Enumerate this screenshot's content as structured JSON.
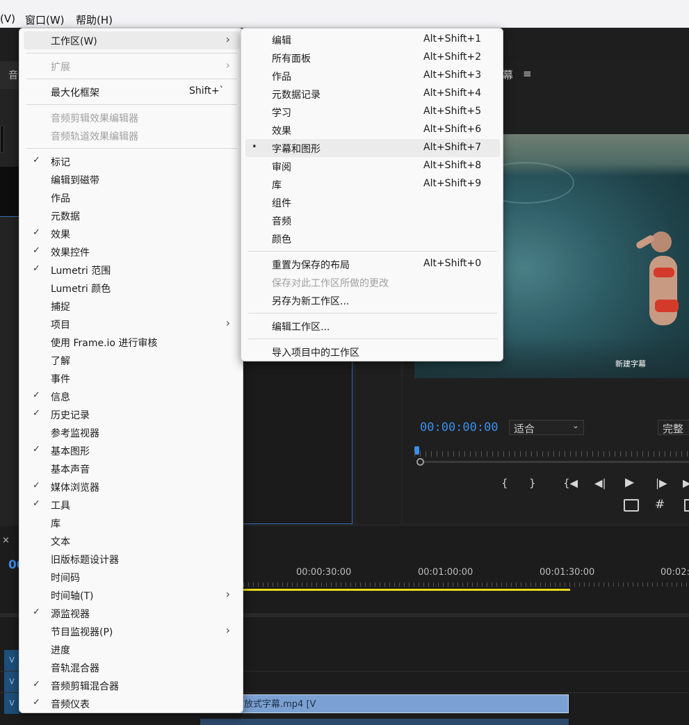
{
  "menubar": {
    "items": [
      {
        "label": "(V)"
      },
      {
        "label": "窗口(W)"
      },
      {
        "label": "帮助(H)"
      }
    ]
  },
  "panels": {
    "tab_partial_left": "音",
    "program_tab_partial": "幕",
    "program_menu_icon": "≡",
    "subtitle_overlay": "新建字幕",
    "timecode": "00:00:00:00",
    "fit_select": "适合",
    "quality_select": "完整",
    "timeline_tab_close": "×",
    "timeline_timecode_partial": "00",
    "ruler_labels": [
      "00:00:30:00",
      "00:01:00:00",
      "00:01:30:00",
      "00:02:"
    ],
    "track_labels": [
      "V",
      "V",
      "V"
    ],
    "clip_label": "放式字幕.mp4 [V"
  },
  "window_menu": {
    "items": [
      {
        "label": "工作区(W)",
        "submenu": true,
        "highlighted": true
      },
      {
        "sep": true
      },
      {
        "label": "扩展",
        "submenu": true,
        "disabled": true
      },
      {
        "sep": true
      },
      {
        "label": "最大化框架",
        "shortcut": "Shift+`"
      },
      {
        "sep": true
      },
      {
        "label": "音频剪辑效果编辑器",
        "disabled": true
      },
      {
        "label": "音频轨道效果编辑器",
        "disabled": true
      },
      {
        "sep": true
      },
      {
        "label": "标记",
        "checked": true
      },
      {
        "label": "编辑到磁带"
      },
      {
        "label": "作品"
      },
      {
        "label": "元数据"
      },
      {
        "label": "效果",
        "checked": true
      },
      {
        "label": "效果控件",
        "checked": true
      },
      {
        "label": "Lumetri 范围",
        "checked": true
      },
      {
        "label": "Lumetri 颜色"
      },
      {
        "label": "捕捉"
      },
      {
        "label": "项目",
        "submenu": true
      },
      {
        "label": "使用 Frame.io 进行审核"
      },
      {
        "label": "了解"
      },
      {
        "label": "事件"
      },
      {
        "label": "信息",
        "checked": true
      },
      {
        "label": "历史记录",
        "checked": true
      },
      {
        "label": "参考监视器"
      },
      {
        "label": "基本图形",
        "checked": true
      },
      {
        "label": "基本声音"
      },
      {
        "label": "媒体浏览器",
        "checked": true
      },
      {
        "label": "工具",
        "checked": true
      },
      {
        "label": "库"
      },
      {
        "label": "文本"
      },
      {
        "label": "旧版标题设计器"
      },
      {
        "label": "时间码"
      },
      {
        "label": "时间轴(T)",
        "submenu": true
      },
      {
        "label": "源监视器",
        "checked": true
      },
      {
        "label": "节目监视器(P)",
        "submenu": true
      },
      {
        "label": "进度"
      },
      {
        "label": "音轨混合器"
      },
      {
        "label": "音频剪辑混合器",
        "checked": true
      },
      {
        "label": "音频仪表",
        "checked": true
      }
    ]
  },
  "workspace_submenu": {
    "items": [
      {
        "label": "编辑",
        "shortcut": "Alt+Shift+1"
      },
      {
        "label": "所有面板",
        "shortcut": "Alt+Shift+2"
      },
      {
        "label": "作品",
        "shortcut": "Alt+Shift+3"
      },
      {
        "label": "元数据记录",
        "shortcut": "Alt+Shift+4"
      },
      {
        "label": "学习",
        "shortcut": "Alt+Shift+5"
      },
      {
        "label": "效果",
        "shortcut": "Alt+Shift+6"
      },
      {
        "label": "字幕和图形",
        "shortcut": "Alt+Shift+7",
        "bullet": true,
        "highlighted": true
      },
      {
        "label": "审阅",
        "shortcut": "Alt+Shift+8"
      },
      {
        "label": "库",
        "shortcut": "Alt+Shift+9"
      },
      {
        "label": "组件"
      },
      {
        "label": "音频"
      },
      {
        "label": "颜色"
      },
      {
        "sep": true
      },
      {
        "label": "重置为保存的布局",
        "shortcut": "Alt+Shift+0"
      },
      {
        "label": "保存对此工作区所做的更改",
        "disabled": true
      },
      {
        "label": "另存为新工作区..."
      },
      {
        "sep": true
      },
      {
        "label": "编辑工作区..."
      },
      {
        "sep": true
      },
      {
        "label": "导入项目中的工作区"
      }
    ]
  }
}
